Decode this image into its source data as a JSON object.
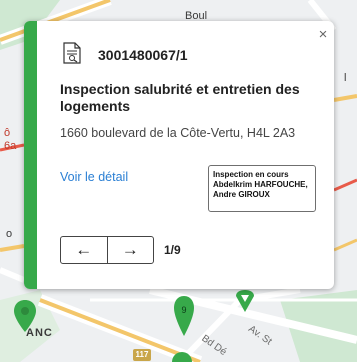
{
  "map": {
    "labels": [
      "Boul",
      "ANC",
      "Bd Dé",
      "Av. St",
      "l",
      "ô",
      "6a",
      "o"
    ],
    "route_number": "117",
    "colors": {
      "land": "#eef0f2",
      "park": "#cfe8d2",
      "road_major": "#f3c66a",
      "road_red": "#e85b4a",
      "road_minor": "#ffffff"
    }
  },
  "popup": {
    "case_number": "3001480067/1",
    "title": "Inspection salubrité et entretien des logements",
    "address": "1660 boulevard de la Côte-Vertu, H4L 2A3",
    "detail_link": "Voir le détail",
    "status": {
      "line1": "Inspection en cours",
      "line2": "Abdelkrim HARFOUCHE,",
      "line3": "Andre GIROUX"
    },
    "pager": "1/9",
    "accent_color": "#37a94a",
    "link_color": "#2a7fd4",
    "icons": {
      "close": "close-icon",
      "file": "document-icon",
      "prev": "arrow-left-icon",
      "next": "arrow-right-icon"
    }
  },
  "symbols": {
    "close": "×",
    "prev": "←",
    "next": "→"
  }
}
